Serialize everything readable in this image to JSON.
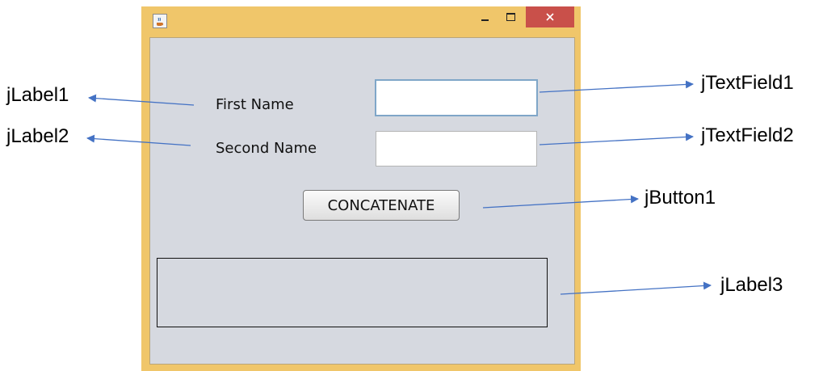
{
  "window": {
    "title": "",
    "controls": {
      "minimize": "minimize",
      "maximize": "maximize",
      "close": "close"
    }
  },
  "form": {
    "first_name_label": "First Name",
    "second_name_label": "Second Name",
    "text_field_1_value": "",
    "text_field_2_value": "",
    "concatenate_button": "CONCATENATE",
    "result_label_text": ""
  },
  "annotations": {
    "jlabel1": "jLabel1",
    "jlabel2": "jLabel2",
    "jtextfield1": "jTextField1",
    "jtextfield2": "jTextField2",
    "jbutton1": "jButton1",
    "jlabel3": "jLabel3"
  },
  "colors": {
    "window_frame": "#f0c66a",
    "client_area": "#d6d9e0",
    "close_button": "#c9504a",
    "arrow": "#4472c4"
  },
  "icons": {
    "app": "java-coffee-cup-icon",
    "minimize": "minimize-icon",
    "maximize": "maximize-icon",
    "close": "close-icon"
  }
}
